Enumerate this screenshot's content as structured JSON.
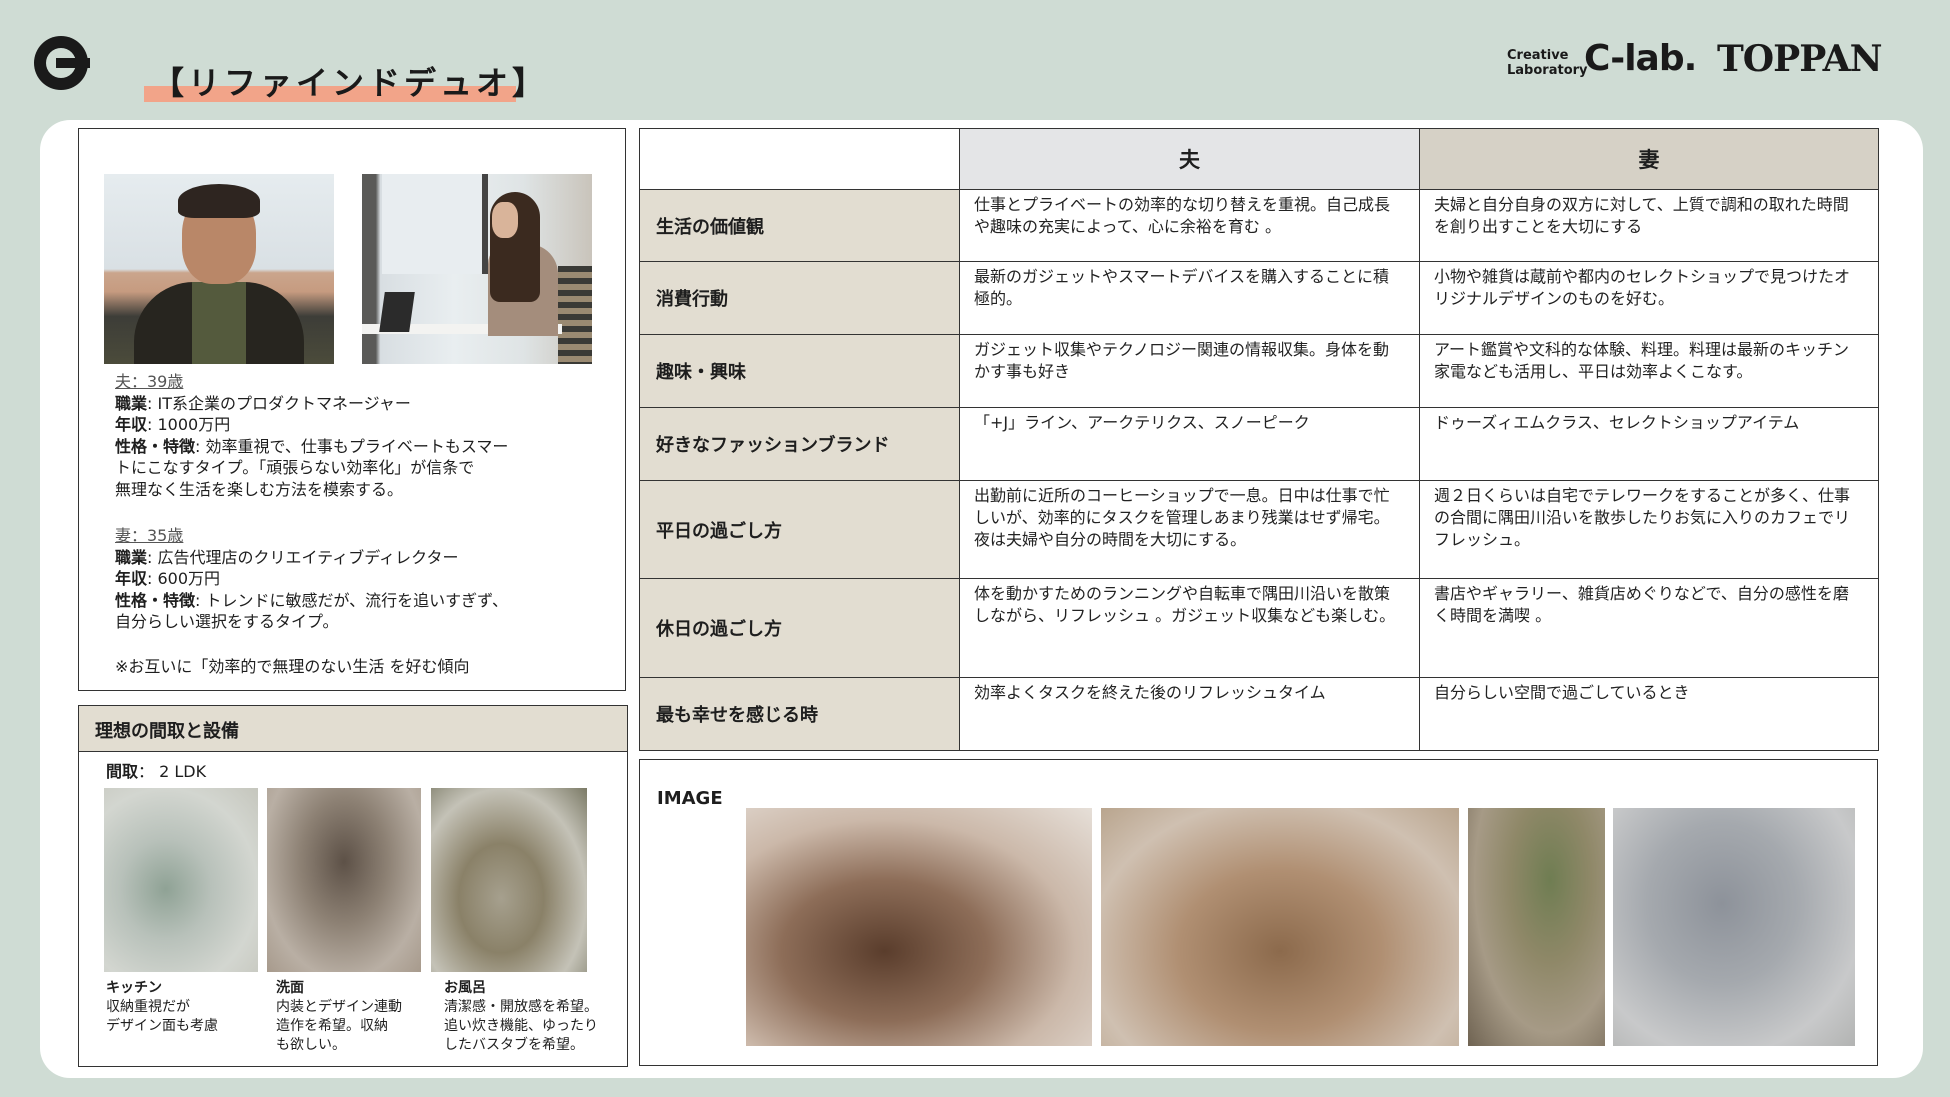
{
  "header": {
    "title": "【リファインドデュオ】",
    "brand_small_line1": "Creative",
    "brand_small_line2": "Laboratory",
    "brand_clab": "C-lab.",
    "brand_toppan": "TOPPAN"
  },
  "persona": {
    "husband": {
      "heading": "夫：39歳",
      "job_label": "職業",
      "job": ": IT系企業のプロダクトマネージャー",
      "income_label": "年収",
      "income": ": 1000万円",
      "personality_label": "性格・特徴",
      "personality_line1": ": 効率重視で、仕事もプライベートもスマー",
      "personality_line2": "トにこなすタイプ。「頑張らない効率化」が信条で",
      "personality_line3": "無理なく生活を楽しむ方法を模索する。"
    },
    "wife": {
      "heading": "妻：35歳",
      "job_label": "職業",
      "job": ": 広告代理店のクリエイティブディレクター",
      "income_label": "年収",
      "income": ": 600万円",
      "personality_label": "性格・特徴",
      "personality_line1": ": トレンドに敏感だが、流行を追いすぎず、",
      "personality_line2": "自分らしい選択をするタイプ。"
    },
    "note": "※お互いに「効率的で無理のない生活 を好む傾向"
  },
  "floor": {
    "heading": "理想の間取と設備",
    "madori_label": "間取",
    "madori_value": "： 2 LDK",
    "items": [
      {
        "title": "キッチン",
        "line1": "収納重視だが",
        "line2": "デザイン面も考慮",
        "line3": ""
      },
      {
        "title": "洗面",
        "line1": "内装とデザイン連動",
        "line2": "造作を希望。収納",
        "line3": "も欲しい。"
      },
      {
        "title": "お風呂",
        "line1": "清潔感・開放感を希望。",
        "line2": "追い炊き機能、ゆったり",
        "line3": "したバスタブを希望。"
      }
    ]
  },
  "table": {
    "col_husband": "夫",
    "col_wife": "妻",
    "rows": [
      {
        "label": "生活の価値観",
        "husband": "仕事とプライベートの効率的な切り替えを重視。自己成長や趣味の充実によって、心に余裕を育む 。",
        "wife": "夫婦と自分自身の双方に対して、上質で調和の取れた時間を創り出すことを大切にする"
      },
      {
        "label": "消費行動",
        "husband": "最新のガジェットやスマートデバイスを購入することに積極的。",
        "wife": "小物や雑貨は蔵前や都内のセレクトショップで見つけたオリジナルデザインのものを好む。"
      },
      {
        "label": "趣味・興味",
        "husband": "ガジェット収集やテクノロジー関連の情報収集。身体を動かす事も好き",
        "wife": "アート鑑賞や文科的な体験、料理。料理は最新のキッチン家電なども活用し、平日は効率よくこなす。"
      },
      {
        "label": "好きなファッションブランド",
        "husband": "「+J」ライン、アークテリクス、スノーピーク",
        "wife": "ドゥーズィエムクラス、セレクトショップアイテム"
      },
      {
        "label": "平日の過ごし方",
        "husband": "出勤前に近所のコーヒーショップで一息。日中は仕事で忙しいが、効率的にタスクを管理しあまり残業はせず帰宅。夜は夫婦や自分の時間を大切にする。",
        "wife": "週２日くらいは自宅でテレワークをすることが多く、仕事の合間に隅田川沿いを散歩したりお気に入りのカフェでリフレッシュ。"
      },
      {
        "label": "休日の過ごし方",
        "husband": "体を動かすためのランニングや自転車で隅田川沿いを散策しながら、リフレッシュ 。ガジェット収集なども楽しむ。",
        "wife": "書店やギャラリー、雑貨店めぐりなどで、自分の感性を磨く時間を満喫 。"
      },
      {
        "label": "最も幸せを感じる時",
        "husband": "効率よくタスクを終えた後のリフレッシュタイム",
        "wife": "自分らしい空間で過ごしているとき"
      }
    ]
  },
  "image_section": {
    "label": "IMAGE"
  }
}
